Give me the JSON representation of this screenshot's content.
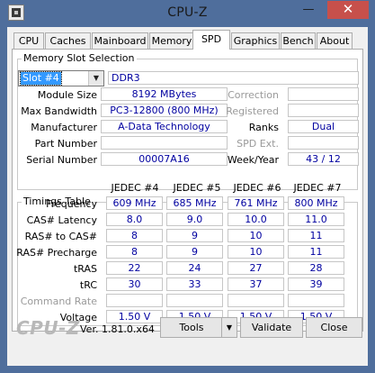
{
  "window": {
    "title": "CPU-Z",
    "minimize_glyph": "—",
    "maximize_glyph": "☐",
    "close_glyph": "✕"
  },
  "tabs": [
    "CPU",
    "Caches",
    "Mainboard",
    "Memory",
    "SPD",
    "Graphics",
    "Bench",
    "About"
  ],
  "active_tab": "SPD",
  "slot_selection": {
    "group_title": "Memory Slot Selection",
    "selected": "Slot #4",
    "memory_type": "DDR3",
    "module_size_label": "Module Size",
    "module_size": "8192 MBytes",
    "max_bandwidth_label": "Max Bandwidth",
    "max_bandwidth": "PC3-12800 (800 MHz)",
    "manufacturer_label": "Manufacturer",
    "manufacturer": "A-Data Technology",
    "part_number_label": "Part Number",
    "part_number": "",
    "serial_number_label": "Serial Number",
    "serial_number": "00007A16",
    "correction_label": "Correction",
    "correction": "",
    "registered_label": "Registered",
    "registered": "",
    "ranks_label": "Ranks",
    "ranks": "Dual",
    "spd_ext_label": "SPD Ext.",
    "spd_ext": "",
    "week_year_label": "Week/Year",
    "week_year": "43 / 12"
  },
  "timings": {
    "group_title": "Timings Table",
    "columns": [
      "JEDEC #4",
      "JEDEC #5",
      "JEDEC #6",
      "JEDEC #7"
    ],
    "rows": [
      {
        "label": "Frequency",
        "values": [
          "609 MHz",
          "685 MHz",
          "761 MHz",
          "800 MHz"
        ]
      },
      {
        "label": "CAS# Latency",
        "values": [
          "8.0",
          "9.0",
          "10.0",
          "11.0"
        ]
      },
      {
        "label": "RAS# to CAS#",
        "values": [
          "8",
          "9",
          "10",
          "11"
        ]
      },
      {
        "label": "RAS# Precharge",
        "values": [
          "8",
          "9",
          "10",
          "11"
        ]
      },
      {
        "label": "tRAS",
        "values": [
          "22",
          "24",
          "27",
          "28"
        ]
      },
      {
        "label": "tRC",
        "values": [
          "30",
          "33",
          "37",
          "39"
        ]
      },
      {
        "label": "Command Rate",
        "values": [
          "",
          "",
          "",
          ""
        ]
      },
      {
        "label": "Voltage",
        "values": [
          "1.50 V",
          "1.50 V",
          "1.50 V",
          "1.50 V"
        ]
      }
    ]
  },
  "footer": {
    "logo": "CPU-Z",
    "version": "Ver. 1.81.0.x64",
    "tools_label": "Tools",
    "validate_label": "Validate",
    "close_label": "Close"
  },
  "colors": {
    "frame": "#4f6e9c",
    "value_text": "#0000a0",
    "close_button": "#c7504b",
    "selection": "#3399ff"
  }
}
